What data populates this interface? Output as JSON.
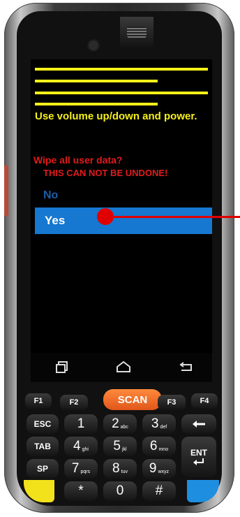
{
  "screen": {
    "instruction": "Use volume up/down and power.",
    "warning": "Wipe all user data?",
    "warning_sub": "THIS CAN NOT BE UNDONE!",
    "options": [
      "No",
      "Yes"
    ],
    "selected_option": "Yes"
  },
  "navbar": {
    "recent_icon": "recent-apps-icon",
    "home_icon": "home-icon",
    "back_icon": "back-icon"
  },
  "keypad": {
    "f1": "F1",
    "f2": "F2",
    "scan": "SCAN",
    "f3": "F3",
    "f4": "F4",
    "esc": "ESC",
    "tab": "TAB",
    "sp": "SP",
    "ent": "ENT",
    "k1": "1",
    "k2": "2",
    "k3": "3",
    "k4": "4",
    "k5": "5",
    "k6": "6",
    "k7": "7",
    "k8": "8",
    "k9": "9",
    "star": "*",
    "k0": "0",
    "hash": "#",
    "k2_sub": "abc",
    "k3_sub": "def",
    "k4_sub": "ghi",
    "k5_sub": "jkl",
    "k6_sub": "mno",
    "k7_sub": "pqrs",
    "k8_sub": "tuv",
    "k9_sub": "wxyz"
  },
  "colors": {
    "text_yellow": "#f4f01a",
    "warning_red": "#e31b1b",
    "selection_blue": "#1678d0",
    "pointer_red": "#e00000",
    "scan_orange": "#f07028"
  }
}
